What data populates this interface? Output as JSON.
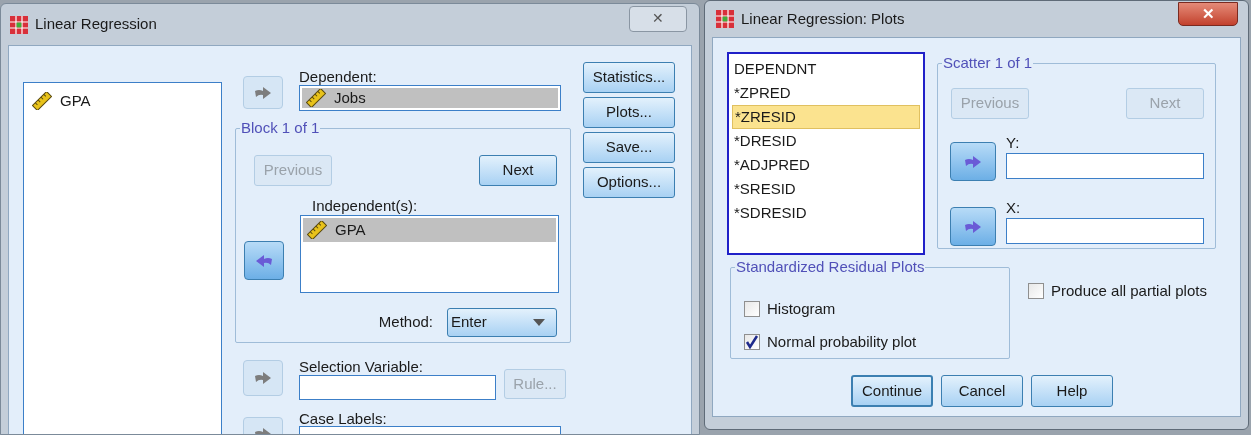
{
  "main_window": {
    "title": "Linear Regression",
    "close": "✕",
    "variables": [
      {
        "name": "GPA",
        "selected": false
      }
    ],
    "dependent": {
      "label": "Dependent:",
      "arrow_disabled": true,
      "value": "Jobs"
    },
    "block": {
      "title": "Block 1 of 1",
      "previous": {
        "label": "Previous",
        "disabled": true
      },
      "next": {
        "label": "Next",
        "disabled": false
      },
      "independent_label": "Independent(s):",
      "arrow_disabled": false,
      "independents": [
        {
          "name": "GPA",
          "selected": true
        }
      ],
      "method": {
        "label": "Method:",
        "value": "Enter"
      }
    },
    "selection_variable": {
      "label": "Selection Variable:",
      "arrow_disabled": true,
      "rule": {
        "label": "Rule...",
        "disabled": true
      }
    },
    "case_labels": {
      "label": "Case Labels:",
      "arrow_disabled": true
    },
    "buttons": [
      {
        "label": "Statistics..."
      },
      {
        "label": "Plots..."
      },
      {
        "label": "Save..."
      },
      {
        "label": "Options..."
      }
    ]
  },
  "plots_window": {
    "title": "Linear Regression: Plots",
    "close": "✕",
    "variables": [
      {
        "name": "DEPENDNT",
        "selected": false
      },
      {
        "name": "*ZPRED",
        "selected": false
      },
      {
        "name": "*ZRESID",
        "selected": true
      },
      {
        "name": "*DRESID",
        "selected": false
      },
      {
        "name": "*ADJPRED",
        "selected": false
      },
      {
        "name": "*SRESID",
        "selected": false
      },
      {
        "name": "*SDRESID",
        "selected": false
      }
    ],
    "scatter": {
      "title": "Scatter 1 of 1",
      "previous": {
        "label": "Previous",
        "disabled": true
      },
      "next": {
        "label": "Next",
        "disabled": true
      },
      "axes": [
        {
          "label": "Y:",
          "arrow_disabled": false
        },
        {
          "label": "X:",
          "arrow_disabled": false
        }
      ]
    },
    "standardized": {
      "title": "Standardized Residual Plots",
      "options": [
        {
          "label": "Histogram",
          "checked": false
        },
        {
          "label": "Normal probability plot",
          "checked": true
        }
      ]
    },
    "partial_plots": {
      "label": "Produce all partial plots",
      "checked": false
    },
    "buttons": [
      {
        "label": "Continue",
        "default": true
      },
      {
        "label": "Cancel",
        "default": false
      },
      {
        "label": "Help",
        "default": false
      }
    ]
  }
}
